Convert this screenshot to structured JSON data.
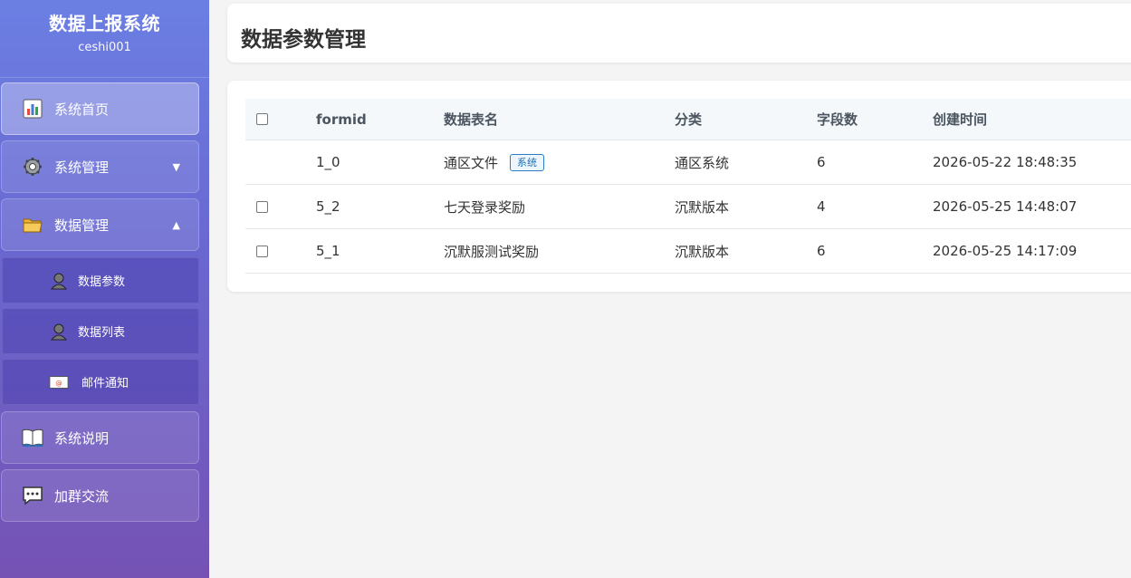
{
  "sidebar": {
    "title": "数据上报系统",
    "user": "ceshi001",
    "items": [
      {
        "label": "系统首页",
        "icon": "bar-chart-icon"
      },
      {
        "label": "系统管理",
        "icon": "gear-icon",
        "arrow": "▼"
      },
      {
        "label": "数据管理",
        "icon": "folder-icon",
        "arrow": "▲"
      },
      {
        "label": "系统说明",
        "icon": "book-icon"
      },
      {
        "label": "加群交流",
        "icon": "chat-icon"
      }
    ],
    "subitems": [
      {
        "label": "数据参数",
        "icon": "user-icon"
      },
      {
        "label": "数据列表",
        "icon": "user-icon"
      },
      {
        "label": "邮件通知",
        "icon": "envelope-icon"
      }
    ]
  },
  "page": {
    "title": "数据参数管理"
  },
  "table": {
    "headers": [
      "formid",
      "数据表名",
      "分类",
      "字段数",
      "创建时间"
    ],
    "rows": [
      {
        "formid": "1_0",
        "name": "通区文件",
        "badge": "系统",
        "category": "通区系统",
        "fields": "6",
        "created": "2026-05-22 18:48:35",
        "has_checkbox": false
      },
      {
        "formid": "5_2",
        "name": "七天登录奖励",
        "badge": "",
        "category": "沉默版本",
        "fields": "4",
        "created": "2026-05-25 14:48:07",
        "has_checkbox": true
      },
      {
        "formid": "5_1",
        "name": "沉默服测试奖励",
        "badge": "",
        "category": "沉默版本",
        "fields": "6",
        "created": "2026-05-25 14:17:09",
        "has_checkbox": true
      }
    ]
  },
  "colors": {
    "accent": "#6a67cf",
    "badge": "#2c7cc7"
  }
}
